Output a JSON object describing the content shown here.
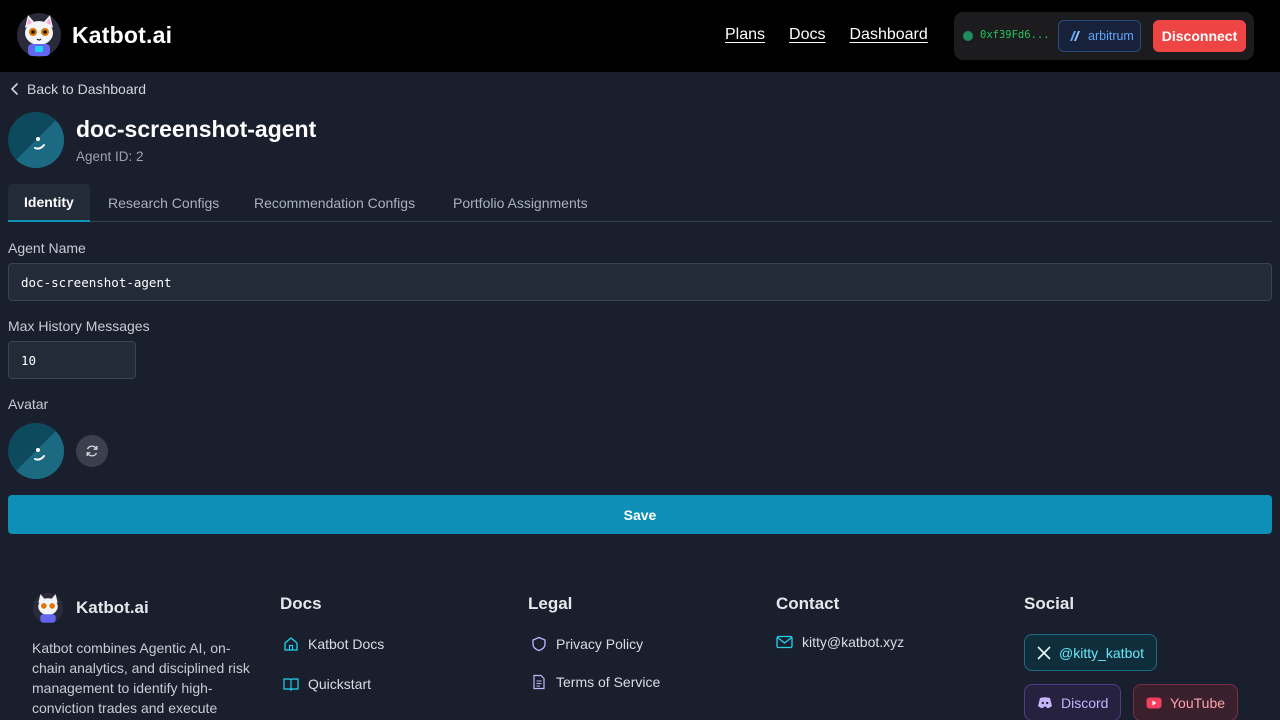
{
  "header": {
    "brand": "Katbot.ai",
    "nav": [
      "Plans",
      "Docs",
      "Dashboard"
    ],
    "wallet_address": "0xf39Fd6...",
    "chain": "arbitrum",
    "disconnect_label": "Disconnect"
  },
  "page": {
    "back_label": "Back to Dashboard",
    "agent_name": "doc-screenshot-agent",
    "agent_id": "Agent ID: 2",
    "tabs": [
      "Identity",
      "Research Configs",
      "Recommendation Configs",
      "Portfolio Assignments"
    ],
    "active_tab": "Identity"
  },
  "form": {
    "agent_name_label": "Agent Name",
    "agent_name_value": "doc-screenshot-agent",
    "max_history_label": "Max History Messages",
    "max_history_value": "10",
    "avatar_label": "Avatar",
    "save_label": "Save"
  },
  "footer": {
    "brand": "Katbot.ai",
    "description": "Katbot combines Agentic AI, on-chain analytics, and disciplined risk management to identify high-conviction trades and execute",
    "docs": {
      "heading": "Docs",
      "links": [
        "Katbot Docs",
        "Quickstart"
      ]
    },
    "legal": {
      "heading": "Legal",
      "links": [
        "Privacy Policy",
        "Terms of Service"
      ]
    },
    "contact": {
      "heading": "Contact",
      "email": "kitty@katbot.xyz"
    },
    "social": {
      "heading": "Social",
      "x_handle": "@kitty_katbot",
      "discord": "Discord",
      "youtube": "YouTube"
    }
  },
  "colors": {
    "accent": "#0e8fb8",
    "danger": "#ef4444",
    "page_bg": "#1a1f2d",
    "header_bg": "#000000"
  }
}
